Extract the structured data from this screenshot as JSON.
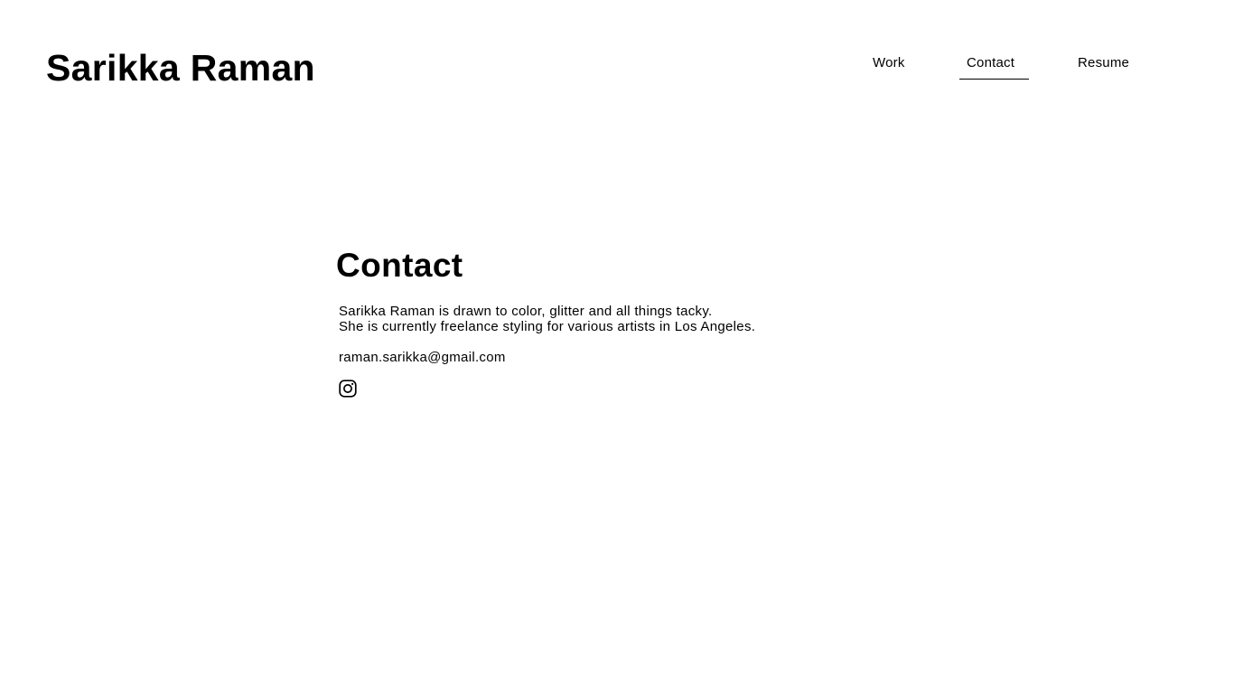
{
  "header": {
    "site_title": "Sarikka Raman"
  },
  "nav": {
    "items": [
      {
        "label": "Work",
        "active": false
      },
      {
        "label": "Contact",
        "active": true
      },
      {
        "label": "Resume",
        "active": false
      }
    ]
  },
  "main": {
    "heading": "Contact",
    "bio_line_1": "Sarikka Raman is drawn to color, glitter and all things tacky.",
    "bio_line_2": "She is currently freelance styling for various artists in Los Angeles.",
    "email": "raman.sarikka@gmail.com",
    "social_icon": "instagram-icon"
  }
}
